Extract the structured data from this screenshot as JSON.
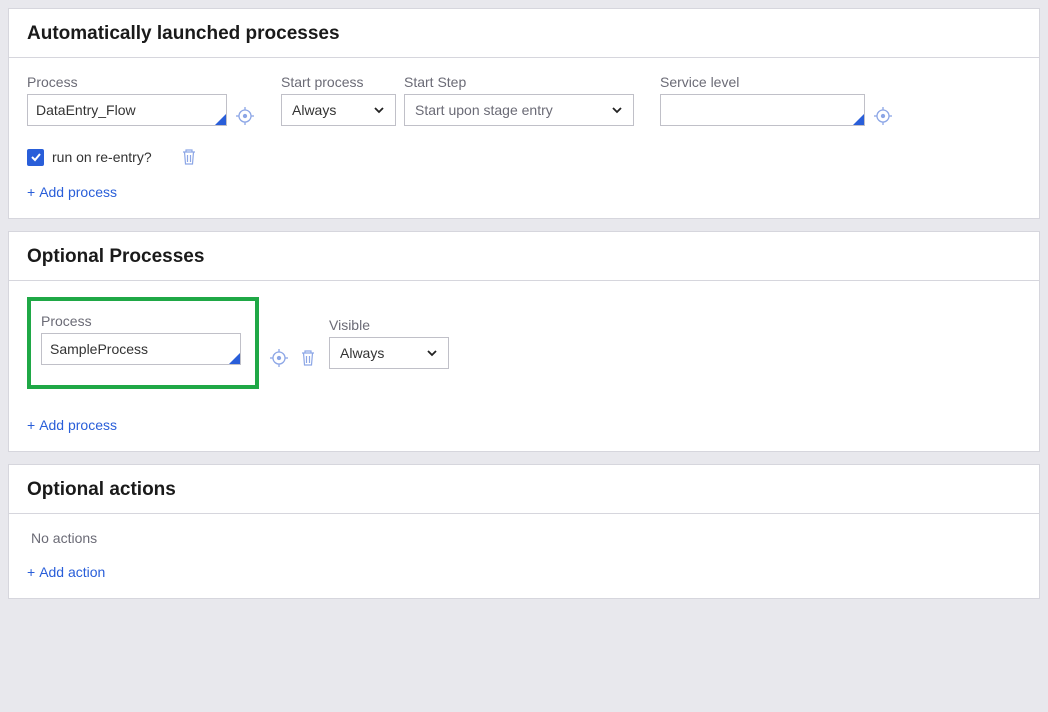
{
  "panels": {
    "auto": {
      "title": "Automatically launched processes",
      "fields": {
        "process": {
          "label": "Process",
          "value": "DataEntry_Flow"
        },
        "start_process": {
          "label": "Start process",
          "value": "Always"
        },
        "start_step": {
          "label": "Start Step",
          "value": "Start upon stage entry"
        },
        "service_level": {
          "label": "Service level",
          "value": ""
        }
      },
      "checkbox_label": "run on re-entry?",
      "add_label": "Add process"
    },
    "optional_processes": {
      "title": "Optional Processes",
      "fields": {
        "process": {
          "label": "Process",
          "value": "SampleProcess"
        },
        "visible": {
          "label": "Visible",
          "value": "Always"
        }
      },
      "add_label": "Add process"
    },
    "optional_actions": {
      "title": "Optional actions",
      "empty_text": "No actions",
      "add_label": "Add action"
    }
  },
  "icons": {
    "plus": "+"
  }
}
